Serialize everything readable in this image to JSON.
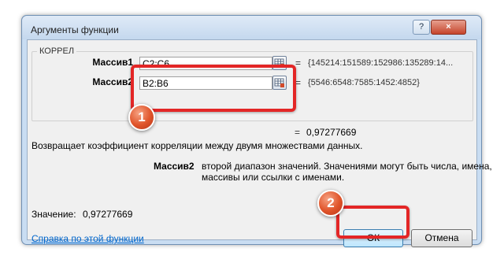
{
  "window": {
    "title": "Аргументы функции",
    "help_glyph": "?",
    "close_glyph": "×"
  },
  "function_name": "КОРРЕЛ",
  "arguments": [
    {
      "label": "Массив1",
      "value": "C2:C6",
      "equals": "=",
      "result": "{145214:151589:152986:135289:14..."
    },
    {
      "label": "Массив2",
      "value": "B2:B6",
      "equals": "=",
      "result": "{5546:6548:7585:1452:4852}"
    }
  ],
  "formula_result": {
    "equals": "=",
    "value": "0,97277669"
  },
  "description": "Возвращает коэффициент корреляции между двумя множествами данных.",
  "arg_help": {
    "name": "Массив2",
    "line1": "второй диапазон значений. Значениями могут быть числа, имена,",
    "line2": "массивы или ссылки с именами."
  },
  "value_line": {
    "label": "Значение:",
    "value": "0,97277669"
  },
  "help_link": "Справка по этой функции",
  "buttons": {
    "ok": "ОК",
    "cancel": "Отмена"
  },
  "annotations": {
    "badge1": "1",
    "badge2": "2",
    "highlight_color": "#e32626"
  }
}
